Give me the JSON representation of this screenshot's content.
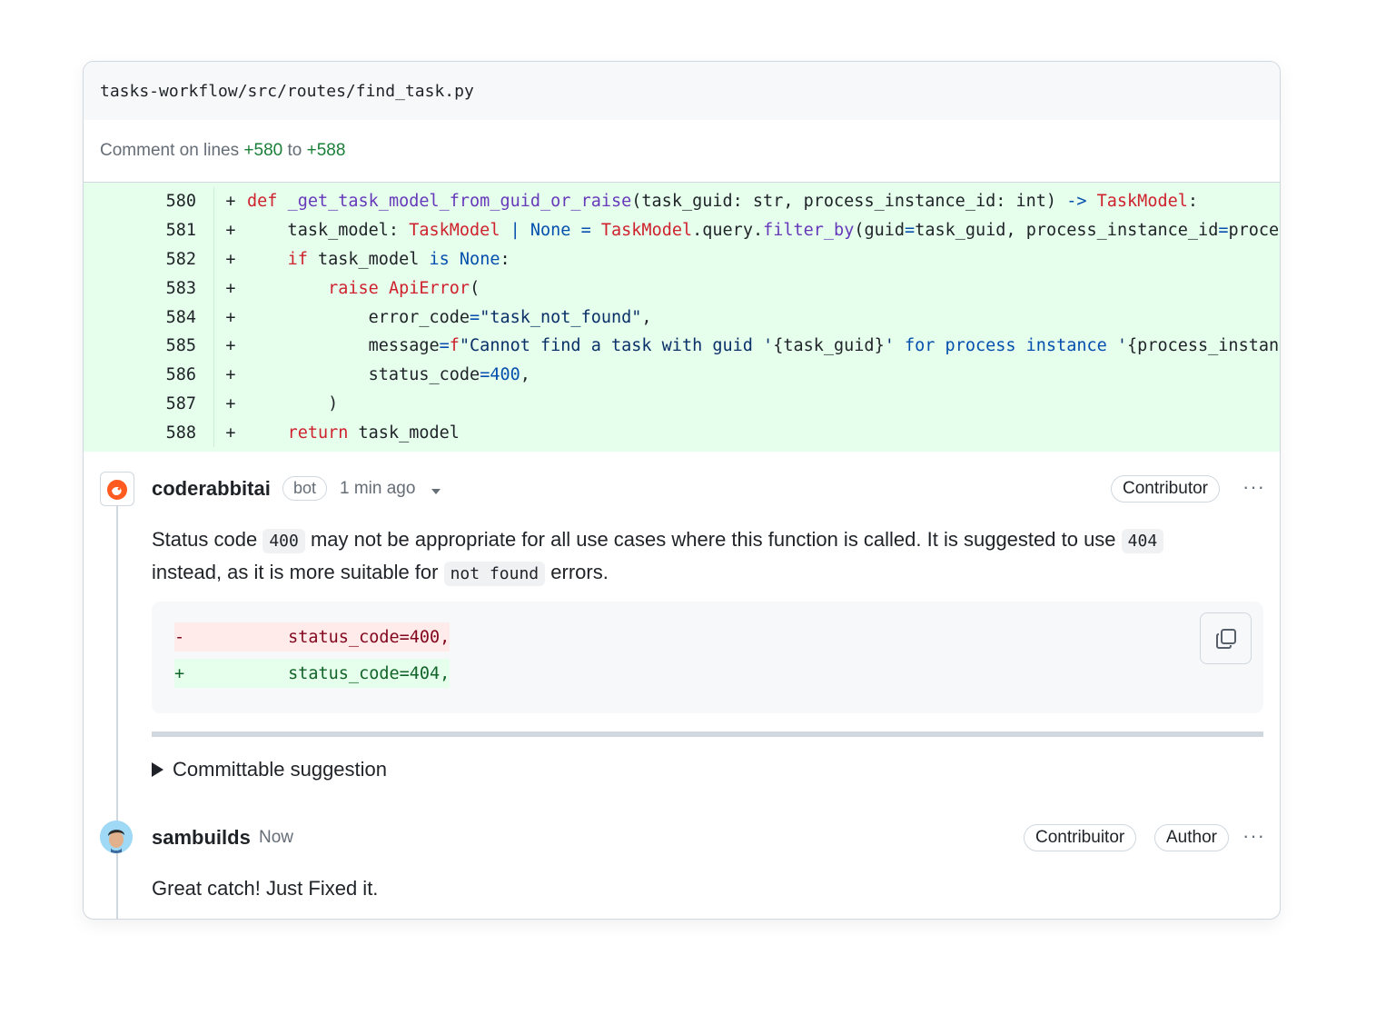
{
  "file": {
    "path": "tasks-workflow/src/routes/find_task.py"
  },
  "comment_range": {
    "prefix": "Comment on lines ",
    "start": "+580",
    "joiner": " to ",
    "end": "+588"
  },
  "diff": {
    "sign": "+",
    "line_numbers": [
      "580",
      "581",
      "582",
      "583",
      "584",
      "585",
      "586",
      "587",
      "588"
    ]
  },
  "comment1": {
    "author": "coderabbitai",
    "badge": "bot",
    "time": "1 min ago",
    "role": "Contributor",
    "more": "···",
    "text": {
      "p1": "Status code ",
      "c1": "400",
      "p2": " may not be appropriate for all use cases where this function is called. It is suggested to use ",
      "c2": "404",
      "p3": " instead, as it is more suitable for ",
      "c3": "not found",
      "p4": " errors."
    },
    "suggestion": {
      "del_sign": "-",
      "del_code": "        status_code=400,",
      "add_sign": "+",
      "add_code": "        status_code=404,"
    },
    "details_label": "Committable suggestion"
  },
  "comment2": {
    "author": "sambuilds",
    "time": "Now",
    "role1": "Contribuitor",
    "role2": "Author",
    "more": "···",
    "text": "Great catch! Just Fixed it."
  },
  "colors": {
    "added_bg": "#e6ffec",
    "removed_bg": "#ffebe9",
    "keyword": "#cf222e",
    "function": "#6639ba",
    "builtin": "#0550ae"
  }
}
